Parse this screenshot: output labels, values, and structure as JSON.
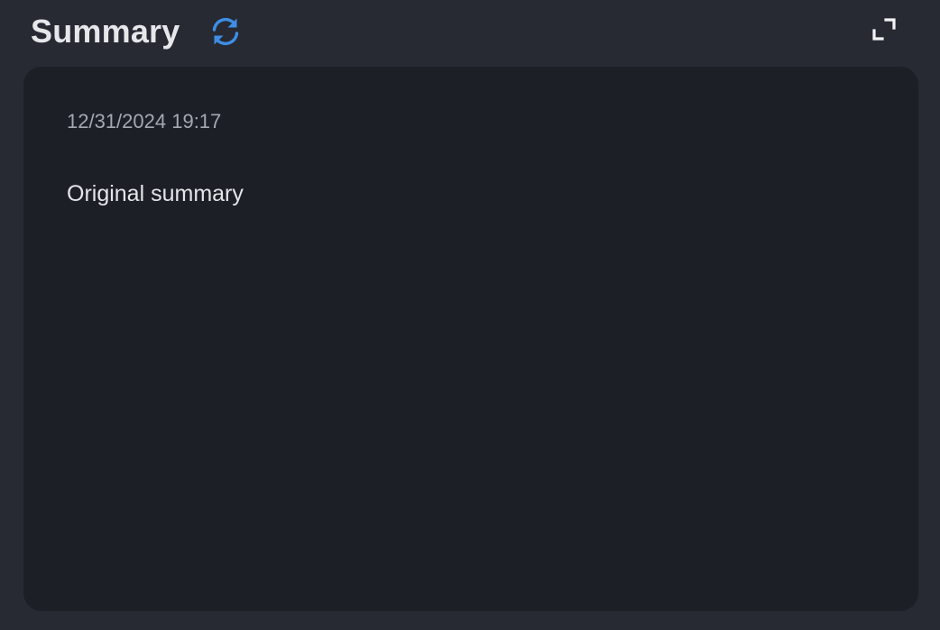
{
  "header": {
    "title": "Summary",
    "refresh_icon": "refresh-icon",
    "expand_icon": "expand-icon"
  },
  "card": {
    "timestamp": "12/31/2024 19:17",
    "summary": "Original summary"
  },
  "colors": {
    "background": "#272a33",
    "card": "#1d1f27",
    "accent": "#3d8fe6",
    "title": "#e6e7ea",
    "timestamp": "#a5a8b1"
  }
}
